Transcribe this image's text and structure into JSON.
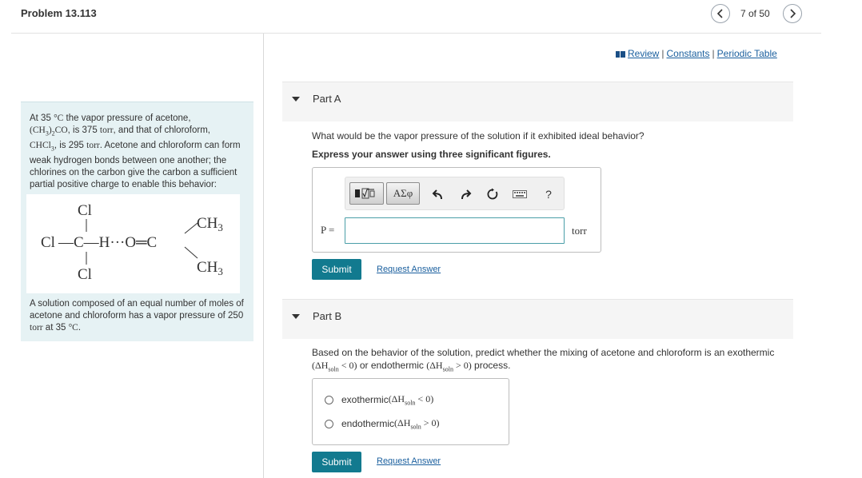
{
  "header": {
    "title": "Problem 13.113",
    "page_indicator": "7 of 50"
  },
  "links": {
    "review": "Review",
    "constants": "Constants",
    "periodic_table": "Periodic Table",
    "separator": "|"
  },
  "intro": {
    "t1": "At 35 ",
    "deg_c": "°C",
    "t2": " the vapor pressure of acetone,",
    "acetone_formula_a": "(CH",
    "acetone_sub1": "3",
    "acetone_formula_b": ")",
    "acetone_sub2": "2",
    "acetone_formula_c": "CO",
    "t3": ", is 375 ",
    "torr1": "torr",
    "t4": ", and that of chloroform,",
    "chloroform_a": "CHCl",
    "chloroform_sub": "3",
    "t5": ", is 295 ",
    "torr2": "torr",
    "t6": ". Acetone and chloroform can form weak hydrogen bonds between one another; the chlorines on the carbon give the carbon a sufficient partial positive charge to enable this behavior:",
    "solution_t1": "A solution composed of an equal number of moles of acetone and chloroform has a vapor pressure of 250 ",
    "solution_torr": "torr",
    "solution_t2": " at 35 ",
    "solution_deg": "°C",
    "solution_t3": "."
  },
  "structure": {
    "cl_top": "Cl",
    "cl_left": "Cl",
    "bond_left": "—C—H···O═C",
    "cl_bottom": "Cl",
    "ch3_top": "CH",
    "ch3_top_sub": "3",
    "ch3_bottom": "CH",
    "ch3_bottom_sub": "3"
  },
  "part_a": {
    "label": "Part A",
    "question": "What would be the vapor pressure of the solution if it exhibited ideal behavior?",
    "instruction": "Express your answer using three significant figures.",
    "symbols_label": "ΑΣφ",
    "help_label": "?",
    "variable_label": "P =",
    "answer_value": "",
    "unit": "torr",
    "submit": "Submit",
    "request": "Request Answer"
  },
  "part_b": {
    "label": "Part B",
    "q1": "Based on the behavior of the solution, predict whether the mixing of acetone and chloroform is an exothermic",
    "q2_a": "(ΔH",
    "q2_sub1": "soln",
    "q2_b": " < 0)",
    "q2_c": " or endothermic ",
    "q2_d": "(ΔH",
    "q2_sub2": "soln",
    "q2_e": " > 0)",
    "q2_f": " process.",
    "choices": [
      {
        "label": "exothermic ",
        "math_a": "(ΔH",
        "math_sub": "soln",
        "math_b": " < 0)"
      },
      {
        "label": "endothermic ",
        "math_a": "(ΔH",
        "math_sub": "soln",
        "math_b": " > 0)"
      }
    ],
    "submit": "Submit",
    "request": "Request Answer"
  },
  "colors": {
    "accent": "#127a8f",
    "link": "#1a5f9e",
    "intro_bg": "#e6f2f4"
  }
}
